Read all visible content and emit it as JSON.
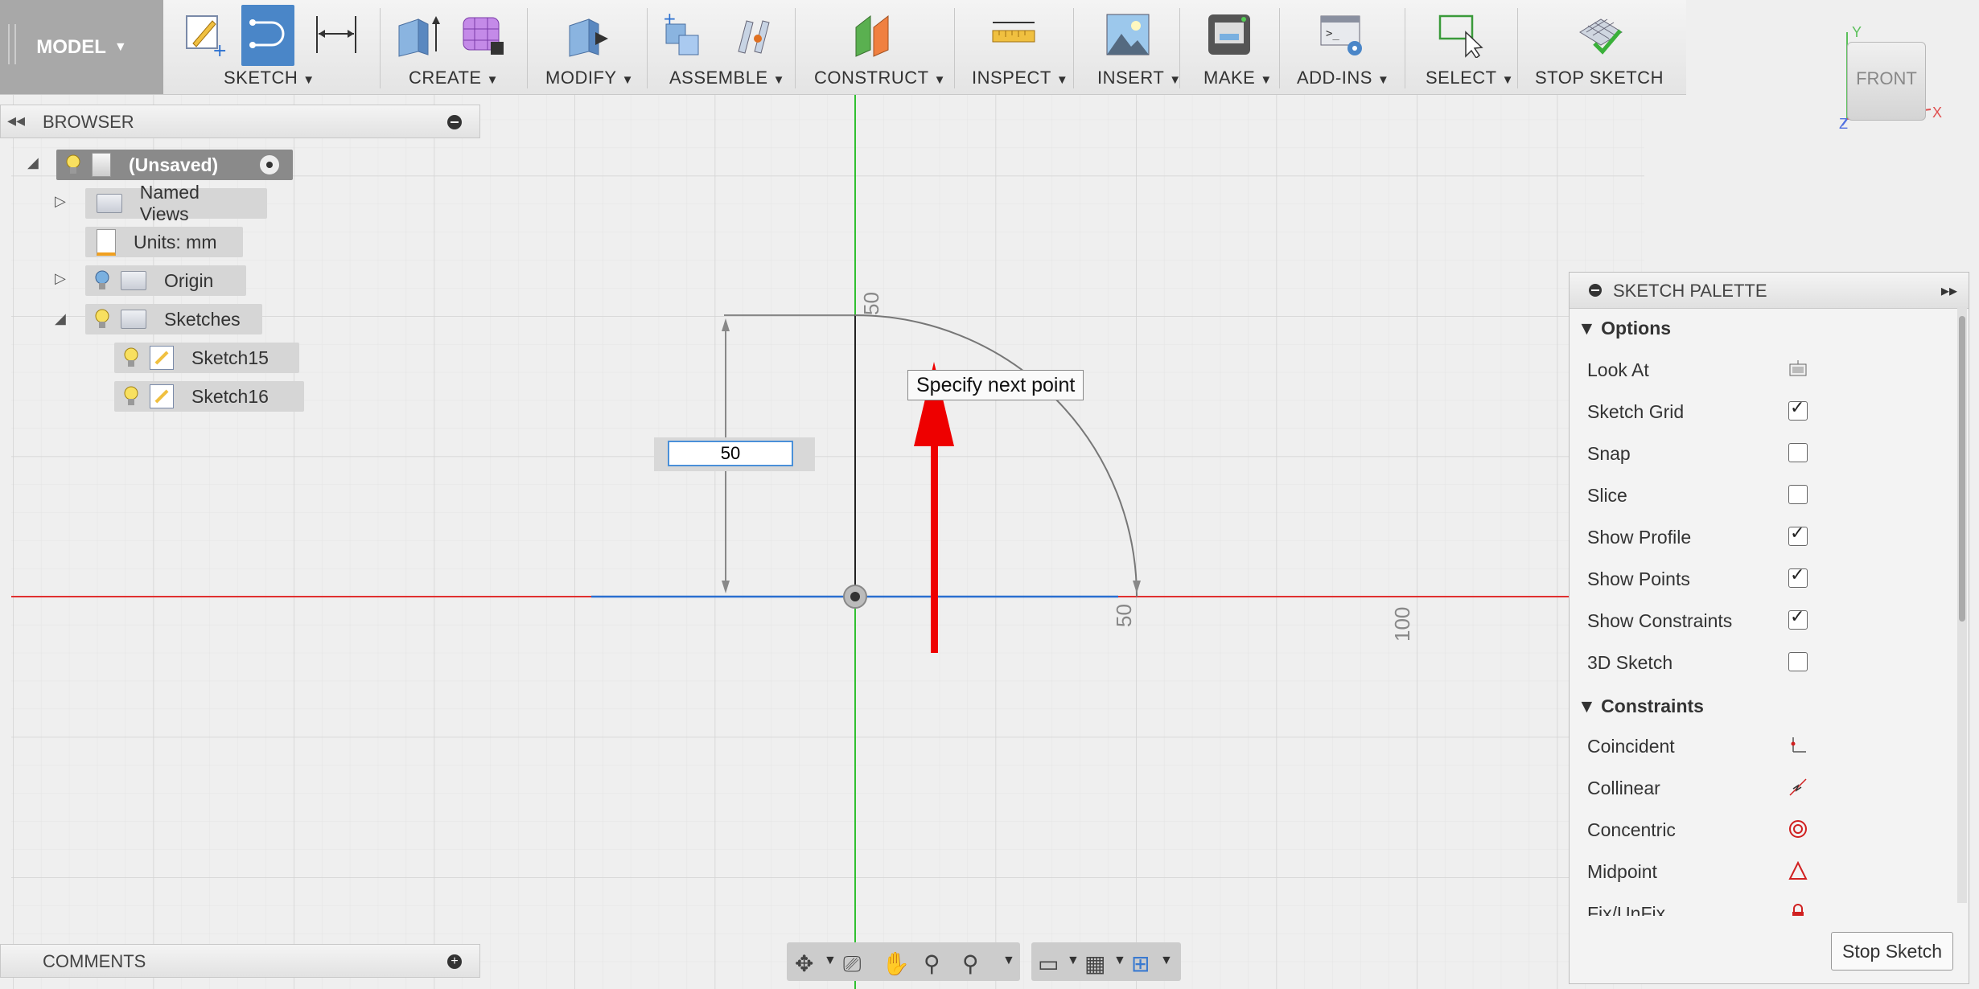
{
  "toolbar": {
    "model": "MODEL",
    "groups": [
      "SKETCH",
      "CREATE",
      "MODIFY",
      "ASSEMBLE",
      "CONSTRUCT",
      "INSPECT",
      "INSERT",
      "MAKE",
      "ADD-INS",
      "SELECT"
    ],
    "stop_sketch": "STOP SKETCH"
  },
  "browser": {
    "title": "BROWSER",
    "items": [
      "(Unsaved)",
      "Named Views",
      "Units: mm",
      "Origin",
      "Sketches",
      "Sketch15",
      "Sketch16"
    ]
  },
  "comments": {
    "title": "COMMENTS"
  },
  "canvas": {
    "dimension_value": "50",
    "tooltip": "Specify next point",
    "axis_labels": {
      "y_50": "50",
      "x_50": "50",
      "x_100": "100"
    }
  },
  "viewcube": {
    "face": "FRONT",
    "axis_x": "X",
    "axis_y": "Y",
    "axis_z": "Z"
  },
  "palette": {
    "title": "SKETCH PALETTE",
    "options_header": "Options",
    "options": [
      {
        "label": "Look At",
        "control": "look-at-icon"
      },
      {
        "label": "Sketch Grid",
        "checked": true
      },
      {
        "label": "Snap",
        "checked": false
      },
      {
        "label": "Slice",
        "checked": false
      },
      {
        "label": "Show Profile",
        "checked": true
      },
      {
        "label": "Show Points",
        "checked": true
      },
      {
        "label": "Show Constraints",
        "checked": true
      },
      {
        "label": "3D Sketch",
        "checked": false
      }
    ],
    "constraints_header": "Constraints",
    "constraints": [
      "Coincident",
      "Collinear",
      "Concentric",
      "Midpoint",
      "Fix/UnFix"
    ],
    "stop_button": "Stop Sketch"
  },
  "colors": {
    "x_axis": "#e03030",
    "y_axis": "#30c030",
    "selection": "#2a6fd0",
    "annotation_arrow": "#ee0000"
  }
}
